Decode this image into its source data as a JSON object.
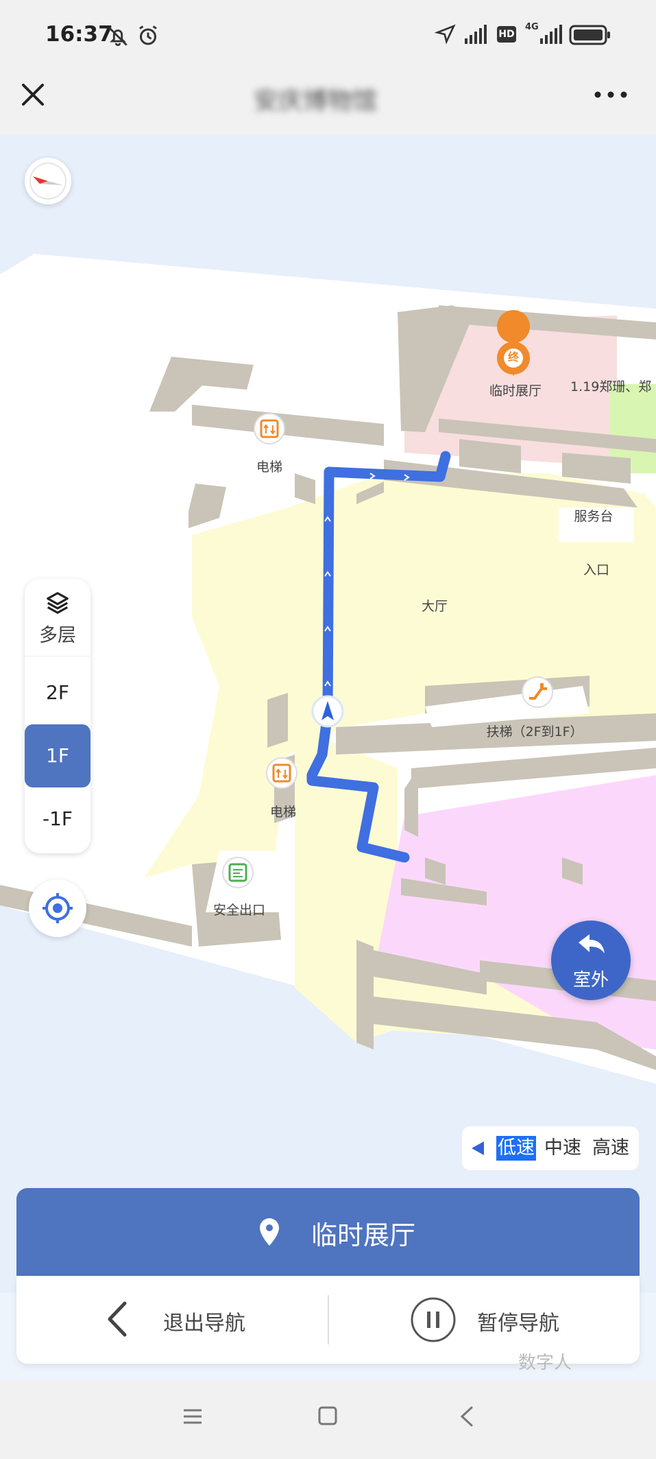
{
  "status": {
    "time": "16:37",
    "network": "4G",
    "hd": "HD"
  },
  "title": {
    "text": "安庆博物馆"
  },
  "map": {
    "labels": {
      "destination_pin": "终",
      "temp_hall": "临时展厅",
      "shop": "1.19郑珊、郑",
      "elevator_top": "电梯",
      "service_desk": "服务台",
      "entrance": "入口",
      "hall": "大厅",
      "escalator": "扶梯（2F到1F）",
      "elevator_bottom": "电梯",
      "safety_exit": "安全出口"
    }
  },
  "floors": {
    "layers_label": "多层",
    "items": [
      "2F",
      "1F",
      "-1F"
    ],
    "active": "1F"
  },
  "outdoor": {
    "label": "室外"
  },
  "speed": {
    "low": "低速",
    "mid": "中速",
    "high": "高速",
    "selected": "低速"
  },
  "destination": {
    "name": "临时展厅"
  },
  "actions": {
    "exit": "退出导航",
    "pause": "暂停导航"
  },
  "partial_text": "数字人",
  "colors": {
    "accent": "#4f74c0",
    "route": "#3f6fe0",
    "poi_orange": "#f08a2a",
    "hall_fill": "#fdfbd3",
    "temp_hall_fill": "#f8dede",
    "exhibit_fill": "#fbd8fb"
  }
}
